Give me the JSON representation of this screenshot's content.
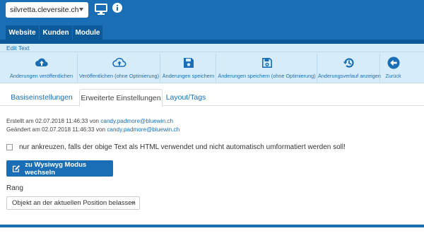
{
  "header": {
    "site": "silvretta.cleversite.ch",
    "nav": [
      "Website",
      "Kunden",
      "Module"
    ]
  },
  "editbar": {
    "label": "Edit Text"
  },
  "toolbar": {
    "items": [
      {
        "label": "Änderungen veröffentlichen",
        "icon": "cloud-upload-icon"
      },
      {
        "label": "Veröffentlichen (ohne Optimierung)",
        "icon": "cloud-upload-outline-icon"
      },
      {
        "label": "Änderungen speichern",
        "icon": "save-icon"
      },
      {
        "label": "Änderungen speichern (ohne Optimierung)",
        "icon": "save-outline-icon"
      },
      {
        "label": "Änderungsverlauf anzeigen",
        "icon": "history-icon"
      },
      {
        "label": "Zurück",
        "icon": "back-arrow-icon"
      }
    ]
  },
  "tabs": [
    "Basiseinstellungen",
    "Erweiterte Einstellungen",
    "Layout/Tags"
  ],
  "meta": {
    "created_prefix": "Erstellt am 02.07.2018 11:46:33 von ",
    "created_by": "candy.padmore@bluewin.ch",
    "changed_prefix": "Geändert am 02.07.2018 11:46:33 von ",
    "changed_by": "candy.padmore@bluewin.ch"
  },
  "checkbox": {
    "label": "nur ankreuzen, falls der obige Text als HTML verwendet und nicht automatisch umformatiert werden soll!",
    "checked": false
  },
  "wysiwyg_button": "zu Wysiwyg Modus wechseln",
  "rang": {
    "label": "Rang",
    "value": "Objekt an der aktuellen Position belassen"
  },
  "colors": {
    "primary": "#1a6eb5",
    "nav_tab": "#0d5a9a",
    "toolbar_bg": "#d6ecf8"
  }
}
